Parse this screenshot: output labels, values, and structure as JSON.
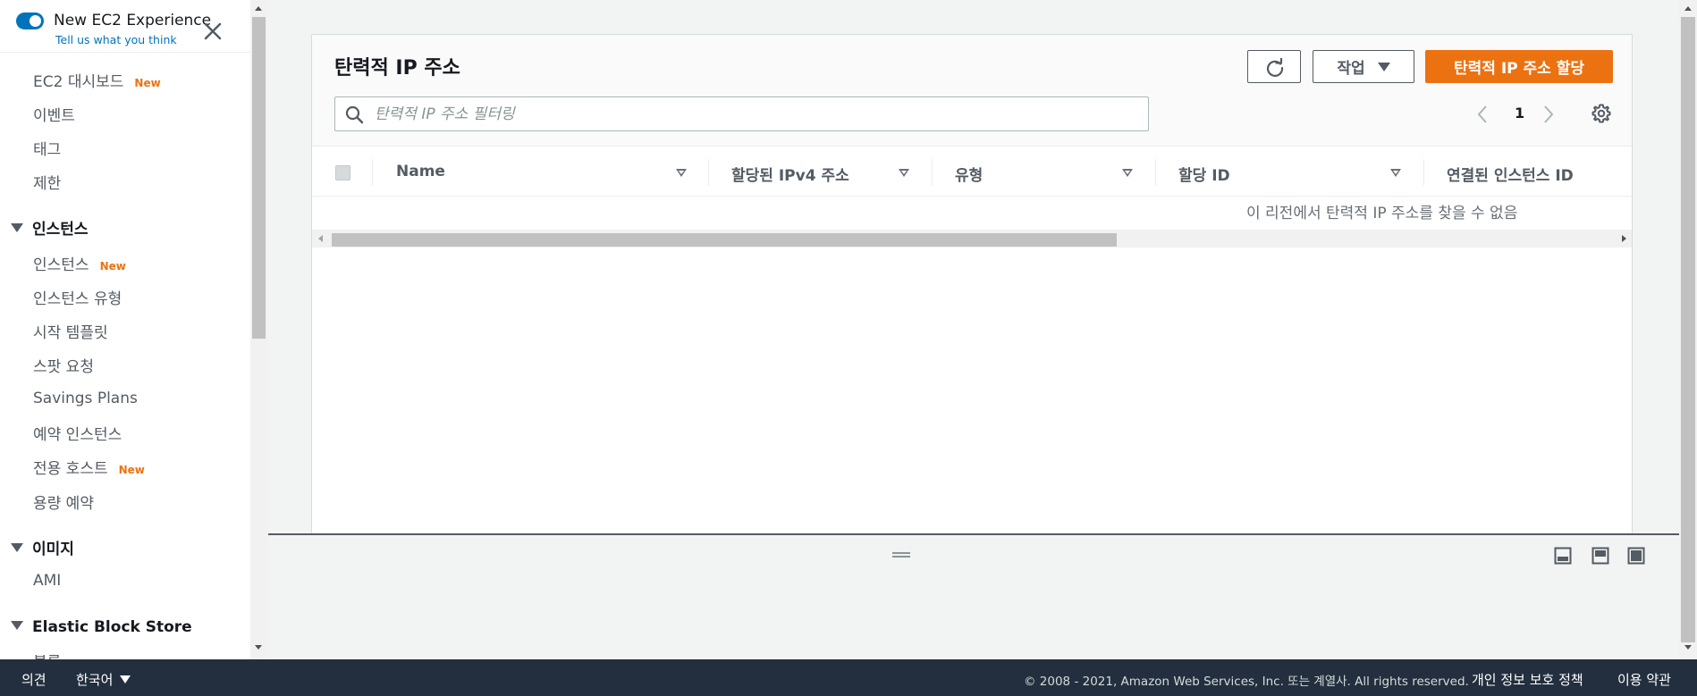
{
  "sidebar": {
    "experience_title": "New EC2 Experience",
    "experience_link": "Tell us what you think",
    "new_badge": "New",
    "items": [
      {
        "label": "EC2 대시보드"
      },
      {
        "label": "이벤트"
      },
      {
        "label": "태그"
      },
      {
        "label": "제한"
      }
    ],
    "sections": {
      "instances": {
        "title": "인스턴스",
        "items": [
          "인스턴스",
          "인스턴스 유형",
          "시작 템플릿",
          "스팟 요청",
          "Savings Plans",
          "예약 인스턴스",
          "전용 호스트",
          "용량 예약"
        ]
      },
      "images": {
        "title": "이미지",
        "items": [
          "AMI"
        ]
      },
      "ebs": {
        "title": "Elastic Block Store",
        "items": [
          "볼륨"
        ]
      }
    }
  },
  "panel": {
    "title": "탄력적 IP 주소",
    "actions_label": "작업",
    "primary_label": "탄력적 IP 주소 할당",
    "search_placeholder": "탄력적 IP 주소 필터링",
    "page_number": "1",
    "columns": [
      "Name",
      "할당된 IPv4 주소",
      "유형",
      "할당 ID",
      "연결된 인스턴스 ID"
    ],
    "empty_message": "이 리전에서 탄력적 IP 주소를 찾을 수 없음"
  },
  "footer": {
    "feedback": "의견",
    "language": "한국어",
    "copyright": "© 2008 - 2021, Amazon Web Services, Inc. 또는 계열사. All rights reserved.",
    "privacy": "개인 정보 보호 정책",
    "terms": "이용 약관"
  },
  "colors": {
    "accent": "#ec7211",
    "link": "#0073bb",
    "footer_bg": "#232f3e"
  }
}
